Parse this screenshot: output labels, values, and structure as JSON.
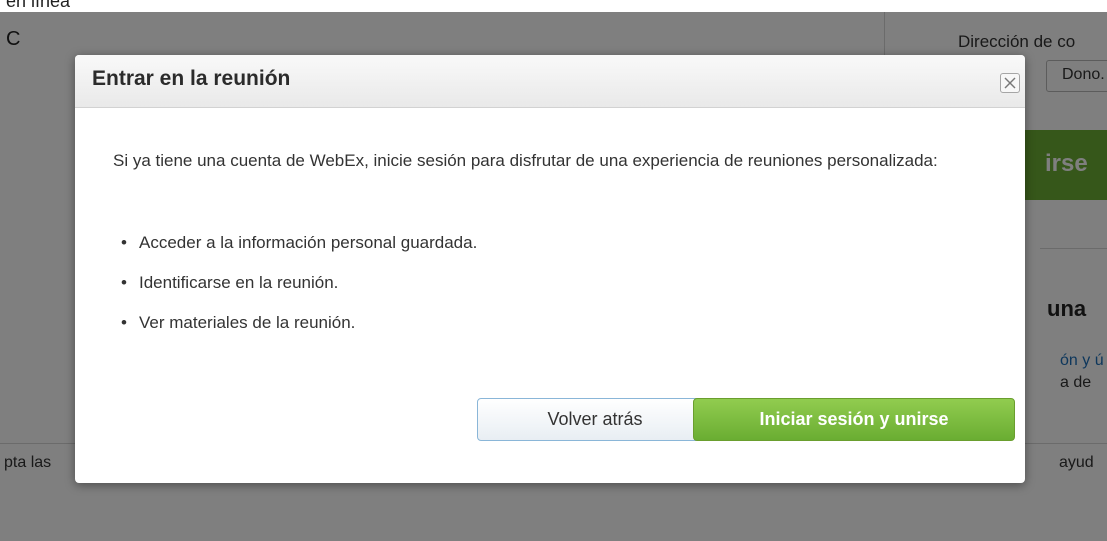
{
  "background": {
    "top_left_line1": "en línea",
    "top_left_line2": "C",
    "direccion_label": "Dirección de co",
    "field_value": "Dono.",
    "green_button_text": "irse",
    "heading_fragment": "una",
    "link_fragment": "ón y ú",
    "text_fragment": "a de",
    "footer_left": "pta las",
    "footer_right": "ayud"
  },
  "dialog": {
    "title": "Entrar en la reunión",
    "close_label": "×",
    "intro": "Si ya tiene una cuenta de WebEx, inicie sesión para disfrutar de una experiencia de reuniones personalizada:",
    "bullets": [
      "Acceder a la información personal guardada.",
      "Identificarse en la reunión.",
      "Ver materiales de la reunión."
    ],
    "back_button": "Volver atrás",
    "login_button": "Iniciar sesión y unirse"
  },
  "colors": {
    "overlay": "#000000",
    "primary_green": "#6aad32",
    "back_border": "#8ab6d8"
  }
}
